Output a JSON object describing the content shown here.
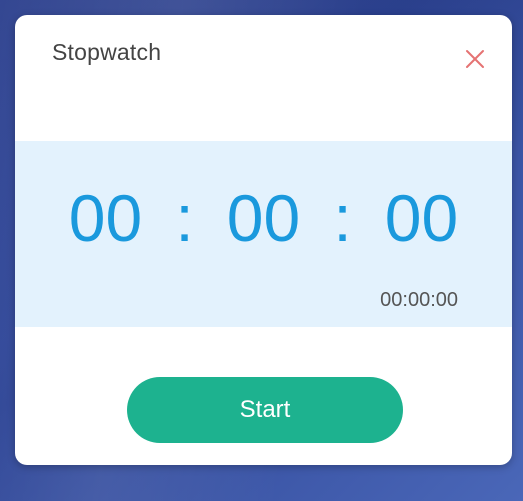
{
  "dialog": {
    "title": "Stopwatch",
    "close_icon": "close-icon"
  },
  "display": {
    "hours": "00",
    "separator_1": ":",
    "minutes": "00",
    "separator_2": ":",
    "seconds": "00",
    "secondary": "00:00:00"
  },
  "controls": {
    "start_label": "Start"
  },
  "colors": {
    "accent_blue": "#1a99dd",
    "panel_background": "#e3f2fd",
    "start_button": "#1db28f",
    "close_icon": "#e57373"
  }
}
